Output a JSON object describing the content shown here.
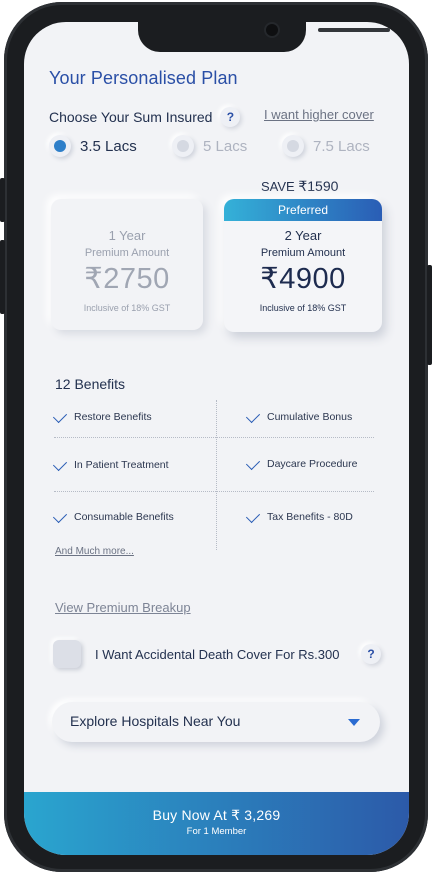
{
  "plan": {
    "title": "Your Personalised Plan",
    "sum_label": "Choose Your Sum Insured",
    "help_icon_text": "?",
    "higher_cover_link": "I want higher cover",
    "options": [
      {
        "label": "3.5 Lacs",
        "selected": true
      },
      {
        "label": "5 Lacs",
        "selected": false
      },
      {
        "label": "7.5 Lacs",
        "selected": false
      }
    ],
    "save_text": "SAVE",
    "save_amount": "₹1590"
  },
  "cards": {
    "one": {
      "year": "1 Year",
      "sub": "Premium Amount",
      "price": "₹2750",
      "gst": "Inclusive of 18% GST"
    },
    "two": {
      "badge": "Preferred",
      "year": "2 Year",
      "sub": "Premium Amount",
      "price": "₹4900",
      "gst": "Inclusive of 18% GST"
    }
  },
  "benefits": {
    "title": "12 Benefits",
    "items": [
      "Restore Benefits",
      "Cumulative Bonus",
      "In Patient Treatment",
      "Daycare Procedure",
      "Consumable Benefits",
      "Tax Benefits - 80D"
    ],
    "more_link": "And Much more..."
  },
  "premium_breakup_link": "View Premium Breakup",
  "accidental": {
    "label": "I Want Accidental Death Cover For Rs.300",
    "checked": false
  },
  "explore": {
    "label": "Explore Hospitals Near You",
    "icon": "chevron-down-icon"
  },
  "buy": {
    "label": "Buy Now At ₹  3,269",
    "sub": "For 1 Member"
  },
  "colors": {
    "accent": "#2a4fa6",
    "gradient_start": "#2aa5cf",
    "gradient_end": "#2c5aa9"
  }
}
